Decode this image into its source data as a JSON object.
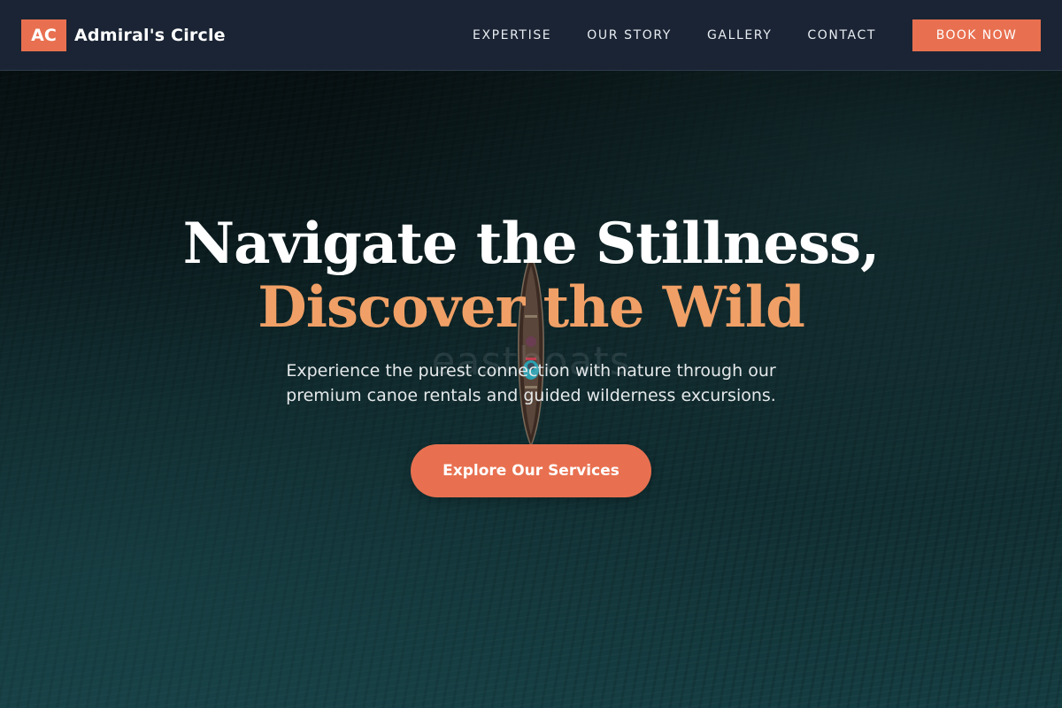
{
  "brand": {
    "mark": "AC",
    "name": "Admiral's Circle",
    "accent_color": "#e87050"
  },
  "nav": {
    "items": [
      {
        "label": "EXPERTISE"
      },
      {
        "label": "OUR STORY"
      },
      {
        "label": "GALLERY"
      },
      {
        "label": "CONTACT"
      }
    ],
    "cta_label": "BOOK NOW"
  },
  "hero": {
    "title_line_1": "Navigate the Stillness,",
    "title_line_2": "Discover the Wild",
    "title_accent_color": "#f0a066",
    "subtitle_line_1": "Experience the purest connection with nature through our",
    "subtitle_line_2": "premium canoe rentals and guided wilderness excursions.",
    "cta_label": "Explore Our Services",
    "image_watermark": "eastboats"
  }
}
